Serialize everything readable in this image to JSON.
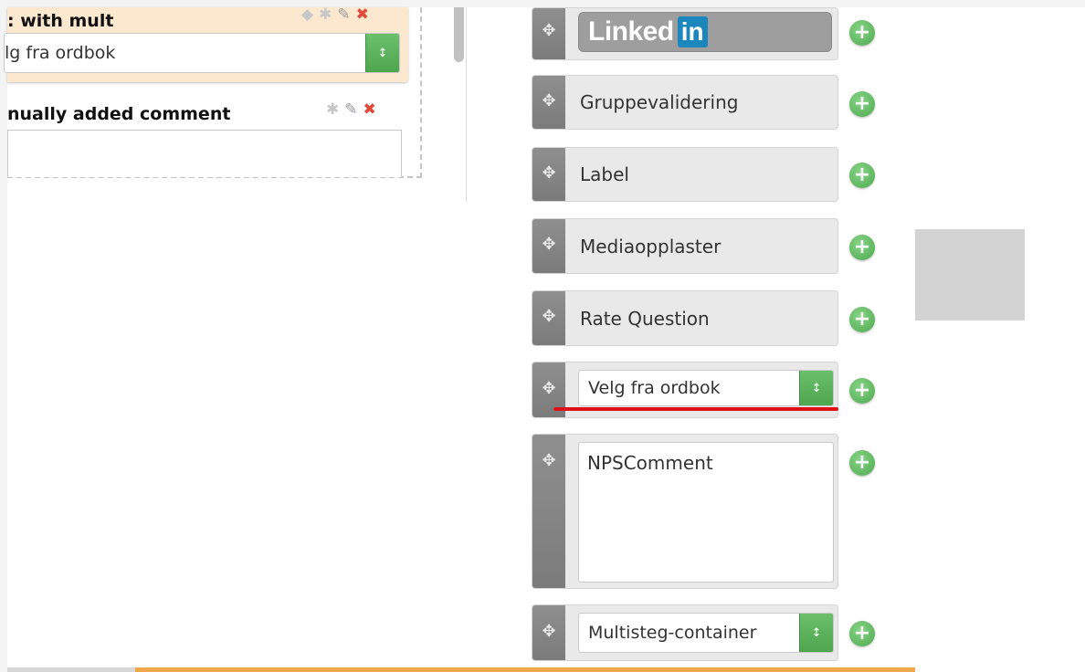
{
  "form": {
    "question1": {
      "title": ": with mult",
      "select_value": "lg fra ordbok"
    },
    "question2": {
      "title": "nually added comment"
    },
    "icons": {
      "comment": "comment-icon",
      "star": "star-icon",
      "pencil": "pencil-icon",
      "delete": "close-icon"
    }
  },
  "toolbox": {
    "items": [
      {
        "type": "logo",
        "logo_text": "Linked",
        "logo_suffix": "in"
      },
      {
        "type": "label",
        "label": "Gruppevalidering"
      },
      {
        "type": "label",
        "label": "Label"
      },
      {
        "type": "label",
        "label": "Mediaopplaster"
      },
      {
        "type": "label",
        "label": "Rate Question"
      },
      {
        "type": "select",
        "value": "Velg fra ordbok"
      },
      {
        "type": "textarea",
        "value": "NPSComment"
      },
      {
        "type": "select",
        "value": "Multisteg-container"
      }
    ],
    "add_symbol": "+",
    "handle_symbol": "⊕"
  },
  "colors": {
    "accent_green": "#4ea64e",
    "delete_red": "#e04a3a",
    "highlight_orange_bg": "#fbe8cf",
    "underline_red": "#e01010",
    "bottom_bar_orange": "#f0a64a"
  }
}
